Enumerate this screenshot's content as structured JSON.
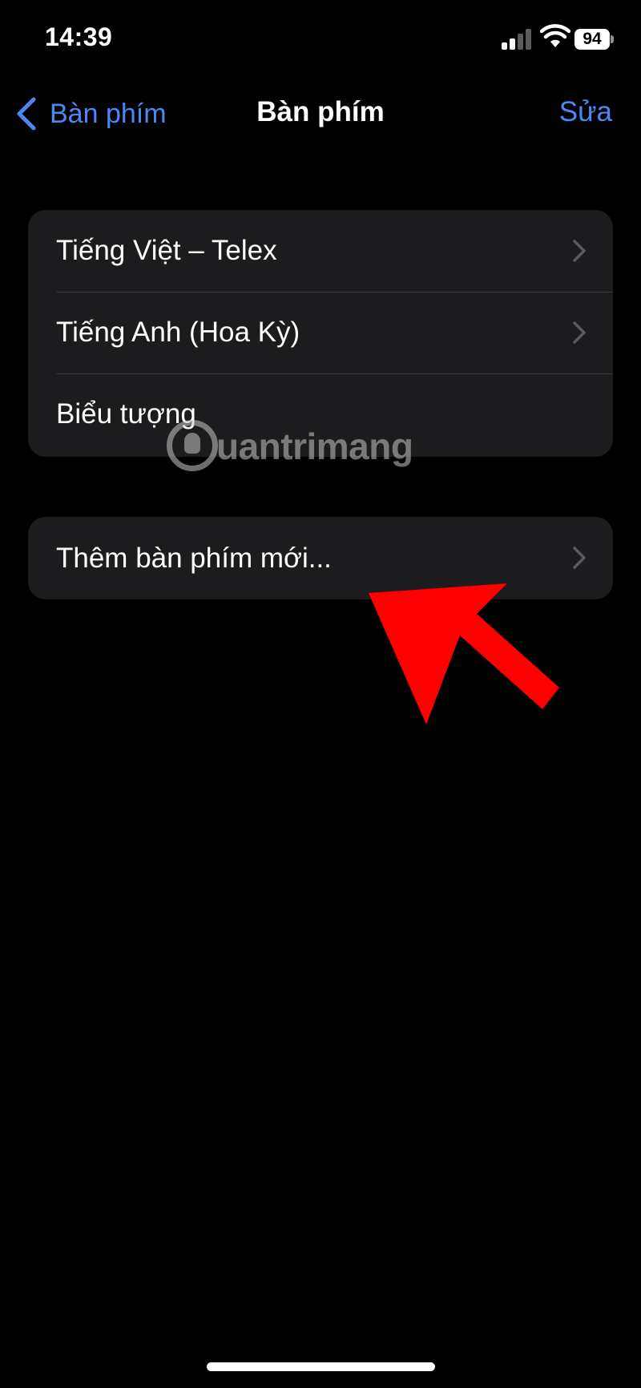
{
  "status_bar": {
    "time": "14:39",
    "battery_percent": "94",
    "signal_bars_active": 2,
    "signal_bars_total": 4,
    "icons": [
      "signal-icon",
      "wifi-icon",
      "battery-icon"
    ]
  },
  "nav": {
    "back_label": "Bàn phím",
    "title": "Bàn phím",
    "edit_label": "Sửa",
    "accent_color": "#4a89f5"
  },
  "keyboards": {
    "items": [
      {
        "label": "Tiếng Việt – Telex",
        "has_chevron": true
      },
      {
        "label": "Tiếng Anh (Hoa Kỳ)",
        "has_chevron": true
      },
      {
        "label": "Biểu tượng",
        "has_chevron": false
      }
    ]
  },
  "add_keyboard": {
    "label": "Thêm bàn phím mới...",
    "has_chevron": true
  },
  "watermark": {
    "text": "uantrimang"
  },
  "annotation": {
    "arrow_color": "#ff0000"
  }
}
